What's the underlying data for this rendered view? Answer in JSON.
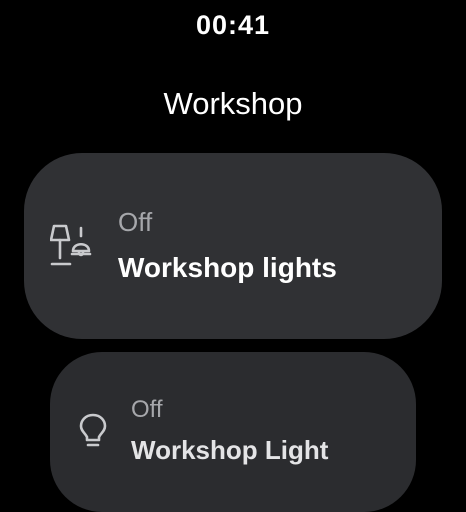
{
  "status_bar": {
    "time": "00:41"
  },
  "header": {
    "title": "Workshop"
  },
  "devices": [
    {
      "status": "Off",
      "label": "Workshop lights",
      "icon": "lamp-group-icon"
    },
    {
      "status": "Off",
      "label": "Workshop Light",
      "icon": "lightbulb-icon"
    }
  ],
  "colors": {
    "background": "#000000",
    "card": "#303134",
    "status_text": "#a6a7ab",
    "label_text": "#ffffff"
  }
}
